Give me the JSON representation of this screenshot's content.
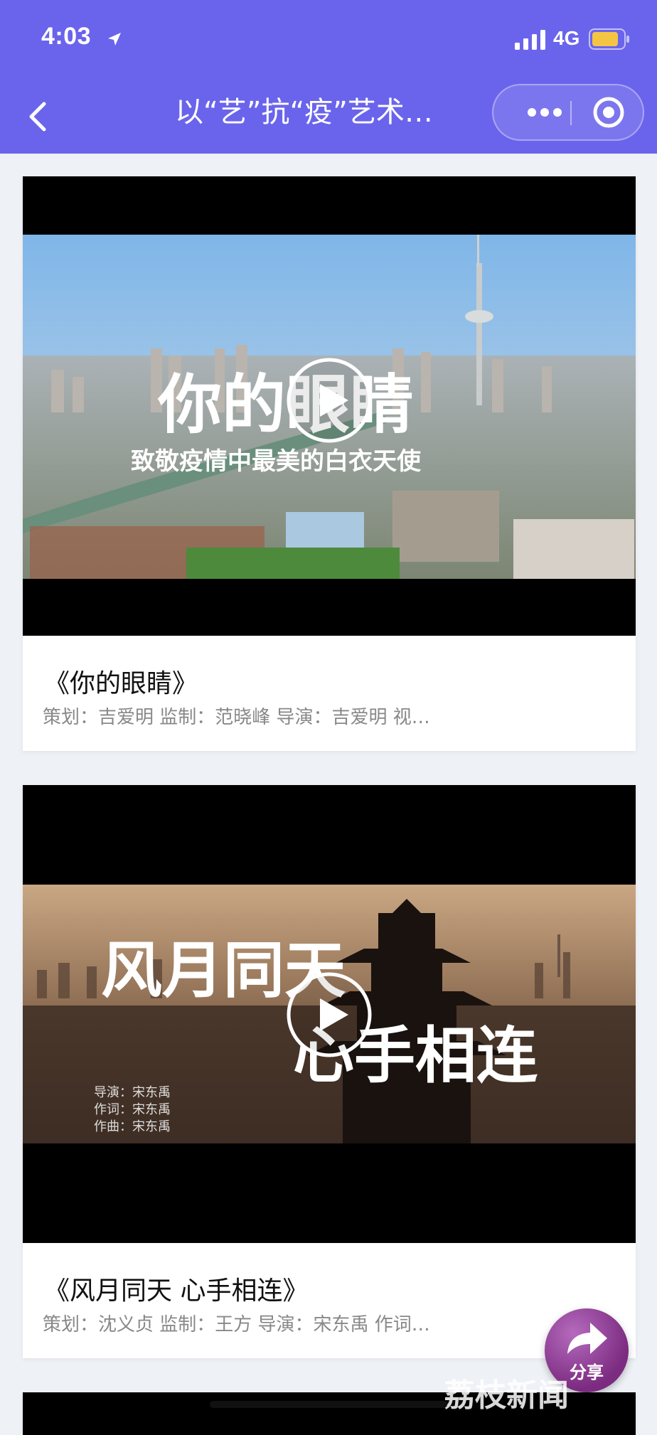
{
  "status_bar": {
    "time": "4:03",
    "network": "4G"
  },
  "nav": {
    "title": "以“艺”抗“疫”艺术…"
  },
  "cards": [
    {
      "thumbnail_heading": "你的眼睛",
      "thumbnail_subheading": "致敬疫情中最美的白衣天使",
      "title": "《你的眼睛》",
      "description": "策划：吉爱明 监制：范晓峰 导演：吉爱明 视…"
    },
    {
      "thumbnail_heading_line1": "风月同天",
      "thumbnail_heading_line2": "心手相连",
      "thumbnail_credits": [
        "导演：宋东禹",
        "作词：宋东禹",
        "作曲：宋东禹"
      ],
      "title": "《风月同天 心手相连》",
      "description": "策划：沈义贞 监制：王方 导演：宋东禹 作词…"
    }
  ],
  "share": {
    "label": "分享"
  },
  "watermark": {
    "text": "荔枝新闻"
  },
  "colors": {
    "header": "#6a64ec",
    "battery": "#f4c542"
  }
}
